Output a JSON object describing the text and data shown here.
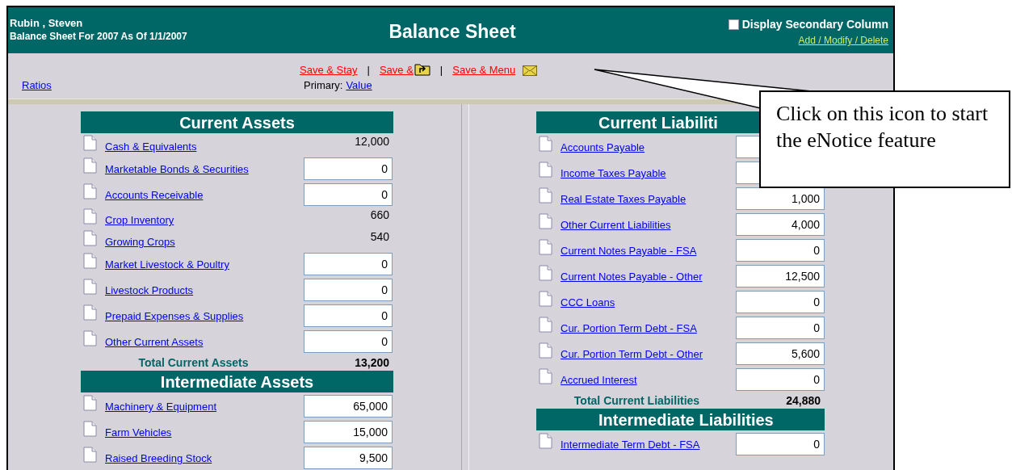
{
  "header": {
    "user_name": "Rubin , Steven",
    "subtitle": "Balance Sheet For 2007 As Of 1/1/2007",
    "title": "Balance Sheet",
    "secondary_column": {
      "label": "Display Secondary Column",
      "checked": false
    },
    "admin_link": "Add / Modify / Delete"
  },
  "toolbar": {
    "actions": [
      {
        "label": "Save & Stay",
        "kind": "text"
      },
      {
        "label": "Save &",
        "kind": "folder_icon"
      },
      {
        "label": "Save & Menu",
        "kind": "mail_icon"
      }
    ],
    "separator": "|",
    "ratios_link": "Ratios",
    "primary_label": "Primary:",
    "primary_link": "Value"
  },
  "left_sections": [
    {
      "title": "Current Assets",
      "rows": [
        {
          "label": "Cash & Equivalents",
          "kind": "display",
          "value": "12,000"
        },
        {
          "label": "Marketable Bonds & Securities",
          "kind": "input",
          "value": "0"
        },
        {
          "label": "Accounts Receivable",
          "kind": "input",
          "value": "0"
        },
        {
          "label": "Crop Inventory",
          "kind": "display",
          "value": "660"
        },
        {
          "label": "Growing Crops",
          "kind": "display",
          "value": "540"
        },
        {
          "label": "Market Livestock & Poultry",
          "kind": "input",
          "value": "0"
        },
        {
          "label": "Livestock Products",
          "kind": "input",
          "value": "0"
        },
        {
          "label": "Prepaid Expenses & Supplies",
          "kind": "input",
          "value": "0"
        },
        {
          "label": "Other Current Assets",
          "kind": "input",
          "value": "0"
        }
      ],
      "total": {
        "label": "Total Current Assets",
        "value": "13,200"
      }
    },
    {
      "title": "Intermediate Assets",
      "rows": [
        {
          "label": "Machinery & Equipment",
          "kind": "input",
          "value": "65,000"
        },
        {
          "label": "Farm Vehicles",
          "kind": "input",
          "value": "15,000"
        },
        {
          "label": "Raised Breeding Stock",
          "kind": "input",
          "value": "9,500"
        }
      ]
    }
  ],
  "right_sections": [
    {
      "title": "Current Liabiliti",
      "rows": [
        {
          "label": "Accounts Payable",
          "kind": "input"
        },
        {
          "label": "Income Taxes Payable",
          "kind": "input"
        },
        {
          "label": "Real Estate Taxes Payable",
          "kind": "input",
          "value": "1,000"
        },
        {
          "label": "Other Current Liabilities",
          "kind": "input",
          "value": "4,000"
        },
        {
          "label": "Current Notes Payable - FSA",
          "kind": "input",
          "value": "0"
        },
        {
          "label": "Current Notes Payable - Other",
          "kind": "input",
          "value": "12,500"
        },
        {
          "label": "CCC Loans",
          "kind": "input",
          "value": "0"
        },
        {
          "label": "Cur. Portion Term Debt - FSA",
          "kind": "input",
          "value": "0"
        },
        {
          "label": "Cur. Portion Term Debt - Other",
          "kind": "input",
          "value": "5,600"
        },
        {
          "label": "Accrued Interest",
          "kind": "input",
          "value": "0"
        }
      ],
      "total": {
        "label": "Total Current Liabilities",
        "value": "24,880"
      }
    },
    {
      "title": "Intermediate Liabilities",
      "rows": [
        {
          "label": "Intermediate Term Debt - FSA",
          "kind": "input",
          "value": "0"
        }
      ]
    }
  ],
  "callout": {
    "text": "Click on this icon to start the eNotice feature"
  }
}
